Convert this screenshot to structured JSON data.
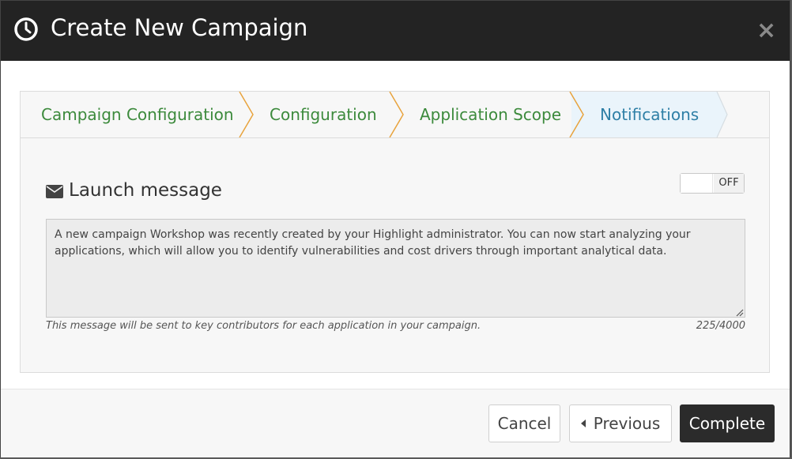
{
  "modal": {
    "title": "Create New Campaign",
    "close_label": "×"
  },
  "steps": [
    {
      "label": "Campaign Configuration",
      "state": "completed"
    },
    {
      "label": "Configuration",
      "state": "completed"
    },
    {
      "label": "Application Scope",
      "state": "completed"
    },
    {
      "label": "Notifications",
      "state": "active"
    }
  ],
  "launch": {
    "title": "Launch message",
    "toggle_label": "OFF",
    "message": "A new campaign Workshop was recently created by your Highlight administrator. You can now start analyzing your applications, which will allow you to identify vulnerabilities and cost drivers through important analytical data.",
    "hint": "This message will be sent to key contributors for each application in your campaign.",
    "counter": "225/4000"
  },
  "footer": {
    "cancel_label": "Cancel",
    "previous_label": "Previous",
    "complete_label": "Complete"
  },
  "colors": {
    "header_bg": "#232323",
    "step_done": "#3c8a3c",
    "step_active": "#2e7fa6",
    "chevron": "#e8a33d",
    "primary_btn": "#2b2b2b"
  }
}
